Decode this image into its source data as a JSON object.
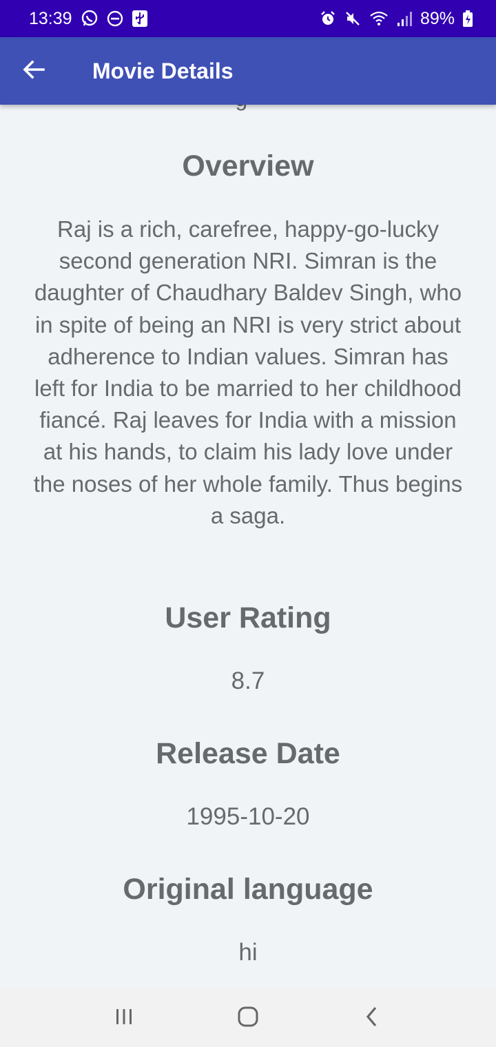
{
  "status_bar": {
    "time": "13:39",
    "battery": "89%",
    "left_icons": [
      "whatsapp-icon",
      "do-not-disturb-icon",
      "usb-icon"
    ],
    "right_icons": [
      "alarm-icon",
      "mute-icon",
      "wifi-icon",
      "signal-icon",
      "battery-charging-icon"
    ]
  },
  "app_bar": {
    "title": "Movie Details",
    "back_icon": "arrow-back-icon"
  },
  "content": {
    "clipped_top_text": "g ·",
    "overview": {
      "heading": "Overview",
      "text": "Raj is a rich, carefree, happy-go-lucky second generation NRI. Simran is the daughter of Chaudhary Baldev Singh, who in spite of being an NRI is very strict about adherence to Indian values. Simran has left for India to be married to her childhood fiancé. Raj leaves for India with a mission at his hands, to claim his lady love under the noses of her whole family. Thus begins a saga."
    },
    "user_rating": {
      "heading": "User Rating",
      "value": "8.7"
    },
    "release_date": {
      "heading": "Release Date",
      "value": "1995-10-20"
    },
    "original_language": {
      "heading": "Original language",
      "value": "hi"
    }
  },
  "nav_bar": {
    "buttons": [
      "recent-apps-icon",
      "home-icon",
      "back-icon"
    ]
  },
  "colors": {
    "status_bar": "#3100b1",
    "app_bar": "#3f51b5",
    "background": "#f0f4f7",
    "text": "#666a6d"
  }
}
